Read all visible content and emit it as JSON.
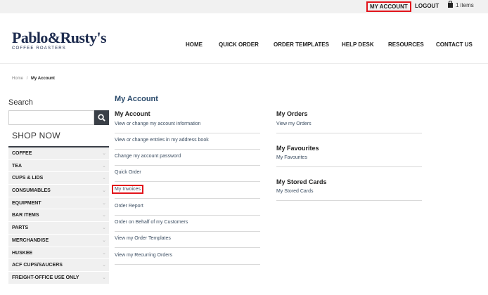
{
  "topbar": {
    "my_account": "MY ACCOUNT",
    "logout": "LOGOUT",
    "cart_count": "1 items"
  },
  "brand": {
    "name": "Pablo&Rusty's",
    "tagline": "COFFEE ROASTERS"
  },
  "nav": [
    "HOME",
    "QUICK ORDER",
    "ORDER TEMPLATES",
    "HELP DESK",
    "RESOURCES",
    "CONTACT US"
  ],
  "breadcrumb": {
    "home": "Home",
    "sep": "/",
    "current": "My Account"
  },
  "sidebar": {
    "search_label": "Search",
    "search_placeholder": "",
    "shop_now": "SHOP NOW",
    "categories": [
      "COFFEE",
      "TEA",
      "CUPS & LIDS",
      "CONSUMABLES",
      "EQUIPMENT",
      "BAR ITEMS",
      "PARTS",
      "MERCHANDISE",
      "HUSKEE",
      "ACF CUPS/SAUCERS",
      "FREIGHT-OFFICE USE ONLY"
    ]
  },
  "main": {
    "title": "My Account",
    "left_heading": "My Account",
    "left_links": [
      "View or change my account information",
      "View or change entries in my address book",
      "Change my account password",
      "Quick Order",
      "My Invoices",
      "Order Report",
      "Order on Behalf of my Customers",
      "View my Order Templates",
      "View my Recurring Orders"
    ],
    "orders_heading": "My Orders",
    "orders_link": "View my Orders",
    "favourites_heading": "My Favourites",
    "favourites_link": "My Favourites",
    "cards_heading": "My Stored Cards",
    "cards_link": "My Stored Cards"
  },
  "colors": {
    "highlight": "#e2141b",
    "brand_navy": "#1d2b4e",
    "title_blue": "#2a4a6b"
  }
}
